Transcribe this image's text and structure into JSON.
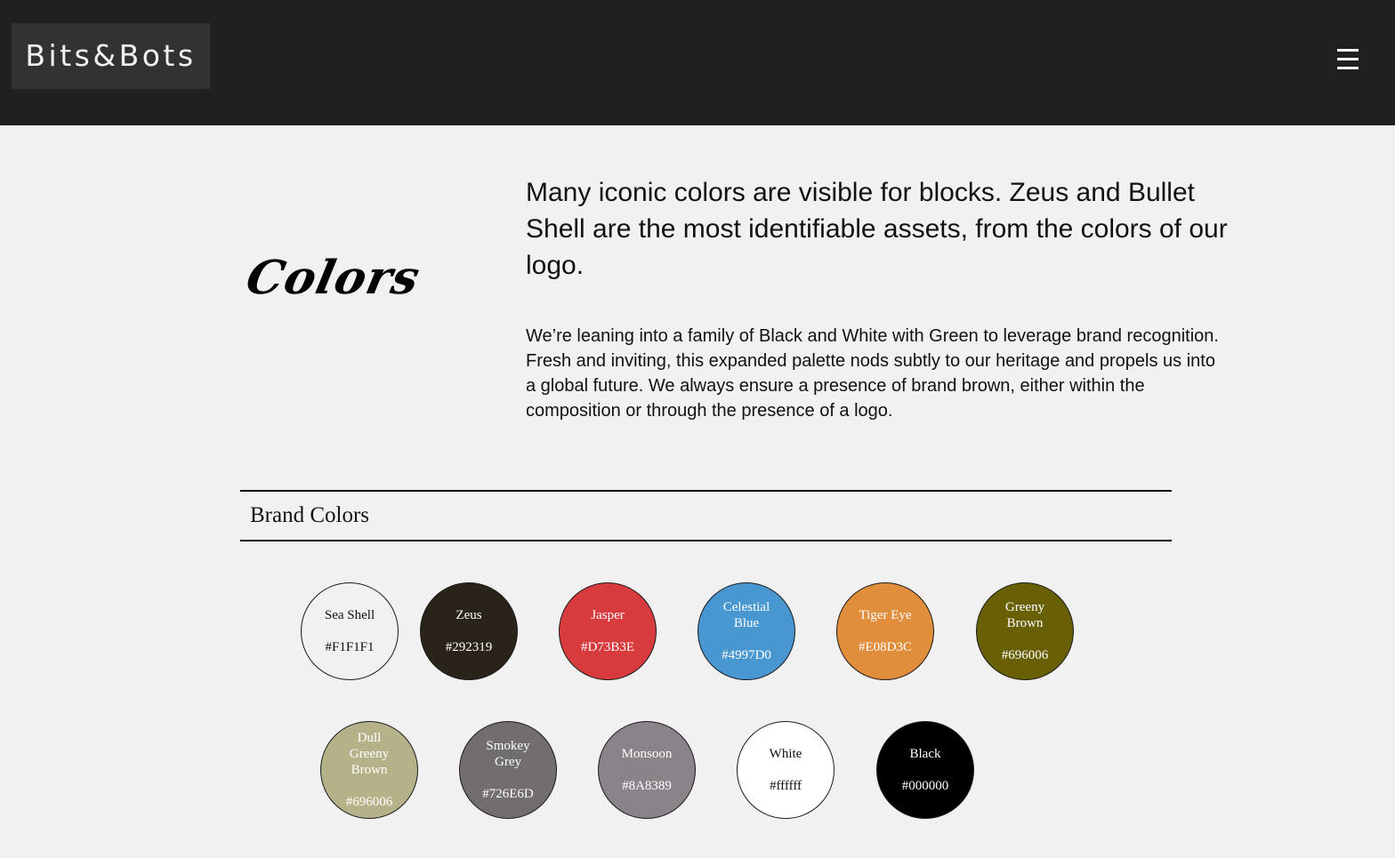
{
  "header": {
    "logo_text": "Bits&Bots",
    "menu_icon": "hamburger-menu-icon",
    "background": "#221f1f"
  },
  "intro": {
    "section_title": "Colors",
    "lead": "Many iconic colors are visible for blocks. Zeus and Bullet Shell are the most identifiable assets, from the colors of our logo.",
    "body": "We’re leaning into a family of Black and White with Green to leverage brand recognition. Fresh and inviting, this expanded palette nods subtly to our heritage and propels us into a global future. We always ensure a presence of brand brown, either within the composition or through the presence of a logo."
  },
  "brand_colors": {
    "heading": "Brand Colors",
    "swatches": [
      {
        "name": "Sea Shell",
        "hex": "#F1F1F1",
        "color": "#F1F1F1",
        "text_color": "#111111"
      },
      {
        "name": "Zeus",
        "hex": "#292319",
        "color": "#292319",
        "text_color": "#ffffff"
      },
      {
        "name": "Jasper",
        "hex": "#D73B3E",
        "color": "#D73B3E",
        "text_color": "#ffffff"
      },
      {
        "name": "Celestial Blue",
        "hex": "#4997D0",
        "color": "#4997D0",
        "text_color": "#ffffff"
      },
      {
        "name": "Tiger Eye",
        "hex": "#E08D3C",
        "color": "#E08D3C",
        "text_color": "#ffffff"
      },
      {
        "name": "Greeny Brown",
        "hex": "#696006",
        "color": "#696006",
        "text_color": "#ffffff"
      },
      {
        "name": "Dull Greeny Brown",
        "hex": "#696006",
        "color": "#B5B289",
        "text_color": "#ffffff"
      },
      {
        "name": "Smokey Grey",
        "hex": "#726E6D",
        "color": "#726E6D",
        "text_color": "#ffffff"
      },
      {
        "name": "Monsoon",
        "hex": "#8A8389",
        "color": "#8A8389",
        "text_color": "#ffffff"
      },
      {
        "name": "White",
        "hex": "#ffffff",
        "color": "#ffffff",
        "text_color": "#111111"
      },
      {
        "name": "Black",
        "hex": "#000000",
        "color": "#000000",
        "text_color": "#ffffff"
      }
    ]
  }
}
